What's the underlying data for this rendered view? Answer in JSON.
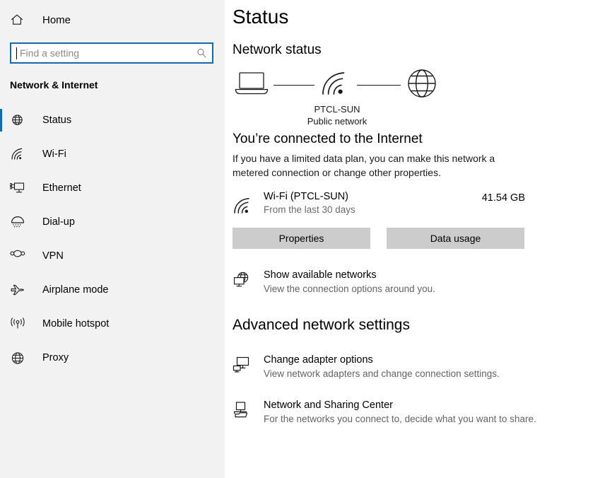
{
  "sidebar": {
    "home": {
      "label": "Home",
      "icon": "home-icon"
    },
    "search": {
      "placeholder": "Find a setting",
      "icon": "search-icon",
      "value": ""
    },
    "category": "Network & Internet",
    "items": [
      {
        "label": "Status",
        "icon": "globe-monitor-icon",
        "selected": true
      },
      {
        "label": "Wi-Fi",
        "icon": "wifi-icon",
        "selected": false
      },
      {
        "label": "Ethernet",
        "icon": "ethernet-icon",
        "selected": false
      },
      {
        "label": "Dial-up",
        "icon": "dialup-icon",
        "selected": false
      },
      {
        "label": "VPN",
        "icon": "vpn-icon",
        "selected": false
      },
      {
        "label": "Airplane mode",
        "icon": "airplane-icon",
        "selected": false
      },
      {
        "label": "Mobile hotspot",
        "icon": "hotspot-icon",
        "selected": false
      },
      {
        "label": "Proxy",
        "icon": "globe-icon",
        "selected": false
      }
    ]
  },
  "main": {
    "page_title": "Status",
    "network_status_heading": "Network status",
    "diagram": {
      "device_icon": "laptop-icon",
      "link_icon": "wifi-icon",
      "internet_icon": "globe-icon",
      "network_name": "PTCL-SUN",
      "network_type": "Public network"
    },
    "connected_heading": "You’re connected to the Internet",
    "connected_description": "If you have a limited data plan, you can make this network a metered connection or change other properties.",
    "connection": {
      "icon": "wifi-icon",
      "name": "Wi-Fi (PTCL-SUN)",
      "subtitle": "From the last 30 days",
      "data_used": "41.54 GB"
    },
    "buttons": [
      {
        "label": "Properties"
      },
      {
        "label": "Data usage"
      }
    ],
    "show_networks": {
      "icon": "globe-monitor-icon",
      "title": "Show available networks",
      "subtitle": "View the connection options around you."
    },
    "advanced_heading": "Advanced network settings",
    "advanced_links": [
      {
        "icon": "adapter-icon",
        "title": "Change adapter options",
        "subtitle": "View network adapters and change connection settings."
      },
      {
        "icon": "sharing-icon",
        "title": "Network and Sharing Center",
        "subtitle": "For the networks you connect to, decide what you want to share."
      }
    ]
  },
  "colors": {
    "accent": "#0a6cbd",
    "sidebar_bg": "#f2f2f2",
    "button_bg": "#cccccc",
    "muted_text": "#6b6b6b"
  }
}
